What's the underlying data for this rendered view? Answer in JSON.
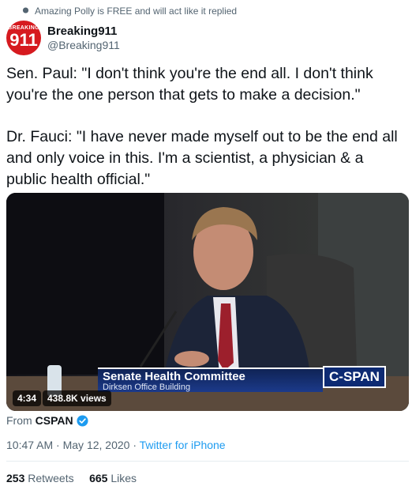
{
  "social_context": {
    "text": "Amazing Polly is FREE and will act like it replied"
  },
  "author": {
    "display_name": "Breaking911",
    "handle": "@Breaking911",
    "avatar_top": "BREAKING",
    "avatar_number": "911"
  },
  "tweet": {
    "paragraph_1": "Sen. Paul: \"I don't think you're the end all. I don't think you're the one person that gets to make a decision.\"",
    "paragraph_2": "Dr. Fauci: \"I have never made myself out to be the end all and only voice in this. I'm a scientist, a physician & a public health official.\""
  },
  "video": {
    "chyron_title": "Senate Health Committee",
    "chyron_subtitle": "Dirksen Office Building",
    "network_logo": "C-SPAN",
    "duration": "4:34",
    "views": "438.8K views"
  },
  "source": {
    "prefix": "From",
    "name": "CSPAN"
  },
  "meta": {
    "time": "10:47 AM",
    "separator": " · ",
    "date": "May 12, 2020",
    "client": "Twitter for iPhone"
  },
  "stats": {
    "retweets_count": "253",
    "retweets_label": "Retweets",
    "likes_count": "665",
    "likes_label": "Likes"
  },
  "colors": {
    "link": "#1d9bf0",
    "secondary_text": "#536471",
    "avatar": "#d61a1f",
    "chyron": "#0f2355"
  }
}
